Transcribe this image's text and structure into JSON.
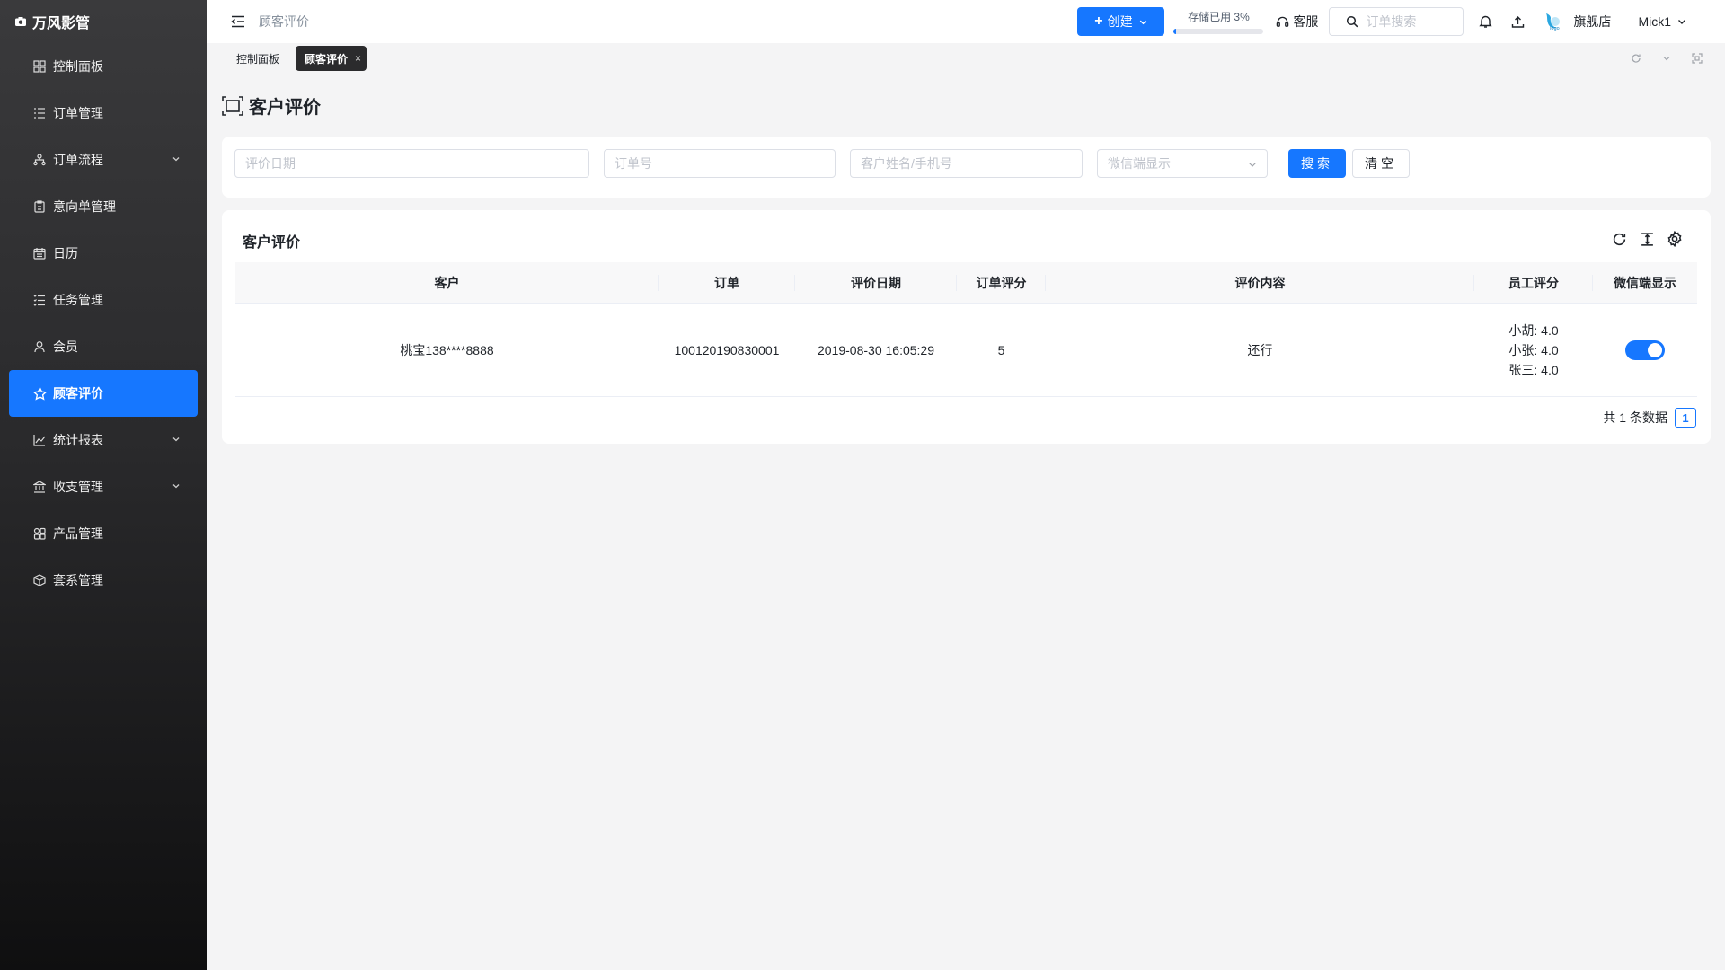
{
  "app": {
    "title": "万风影管"
  },
  "sidebar": {
    "items": [
      {
        "label": "控制面板",
        "icon": "dashboard-icon"
      },
      {
        "label": "订单管理",
        "icon": "list-icon"
      },
      {
        "label": "订单流程",
        "icon": "flow-icon",
        "expandable": true
      },
      {
        "label": "意向单管理",
        "icon": "clipboard-icon"
      },
      {
        "label": "日历",
        "icon": "calendar-icon"
      },
      {
        "label": "任务管理",
        "icon": "task-list-icon"
      },
      {
        "label": "会员",
        "icon": "user-icon"
      },
      {
        "label": "顾客评价",
        "icon": "star-icon",
        "active": true
      },
      {
        "label": "统计报表",
        "icon": "chart-icon",
        "expandable": true
      },
      {
        "label": "收支管理",
        "icon": "bank-icon",
        "expandable": true
      },
      {
        "label": "产品管理",
        "icon": "products-icon"
      },
      {
        "label": "套系管理",
        "icon": "package-icon"
      }
    ]
  },
  "header": {
    "breadcrumb": "顾客评价",
    "create_label": "创建",
    "storage_label": "存储已用 3%",
    "storage_percent": 3,
    "service_label": "客服",
    "search_placeholder": "订单搜索",
    "store_label": "旗舰店",
    "user_name": "Mick1"
  },
  "tabs": [
    {
      "label": "控制面板",
      "active": false
    },
    {
      "label": "顾客评价",
      "active": true,
      "close": "×"
    }
  ],
  "page": {
    "title": "客户评价"
  },
  "filters": {
    "date_placeholder": "评价日期",
    "order_placeholder": "订单号",
    "customer_placeholder": "客户姓名/手机号",
    "wechat_placeholder": "微信端显示",
    "search_label": "搜索",
    "clear_label": "清空"
  },
  "table": {
    "title": "客户评价",
    "columns": [
      "客户",
      "订单",
      "评价日期",
      "订单评分",
      "评价内容",
      "员工评分",
      "微信端显示"
    ],
    "rows": [
      {
        "customer": "桃宝138****8888",
        "order": "100120190830001",
        "date": "2019-08-30 16:05:29",
        "score": "5",
        "content": "还行",
        "staff_scores": [
          "小胡: 4.0",
          "小张: 4.0",
          "张三: 4.0"
        ],
        "wechat_display": true
      }
    ],
    "total_label": "共 1 条数据",
    "current_page": "1"
  },
  "colors": {
    "accent": "#1677ff",
    "sidebar_dark": "#2a2a2c"
  }
}
